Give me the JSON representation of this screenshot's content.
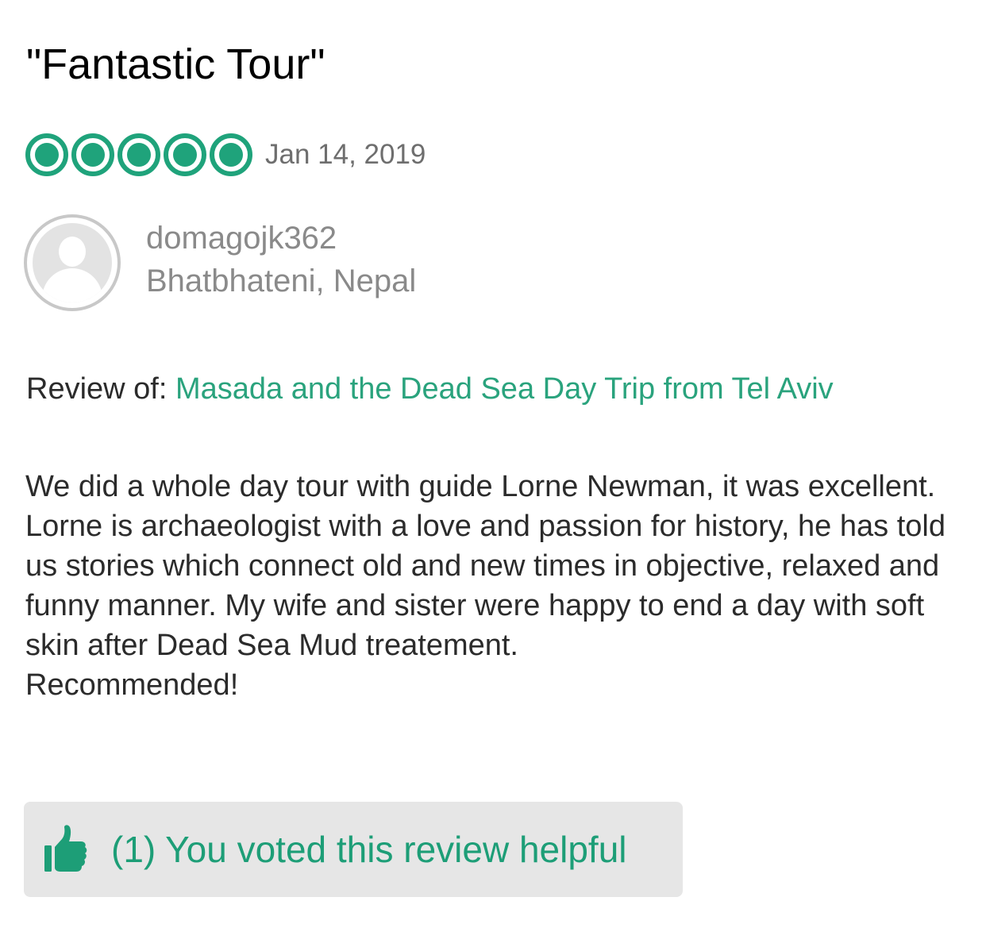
{
  "review": {
    "title": "\"Fantastic Tour\"",
    "rating": 5,
    "rating_max": 5,
    "date": "Jan 14, 2019",
    "bubble_color": "#1fa37b"
  },
  "reviewer": {
    "username": "domagojk362",
    "location": "Bhatbhateni, Nepal",
    "avatar_icon": "default-user-avatar-icon"
  },
  "review_of": {
    "label": "Review of:",
    "link_text": "Masada and the Dead Sea Day Trip from Tel Aviv",
    "link_color": "#2aa37d"
  },
  "body": {
    "paragraph": "We did a whole day tour with guide Lorne Newman, it was excellent. Lorne is archaeologist with a love and passion for history, he has told us stories which connect old and new times in objective, relaxed and funny manner. My wife and sister were happy to end a day with soft skin after Dead Sea Mud treatement.",
    "closing": "Recommended!"
  },
  "helpful": {
    "icon": "thumbs-up-icon",
    "text": "(1) You voted this review helpful",
    "color": "#1d9e77",
    "background": "#e6e6e6"
  }
}
